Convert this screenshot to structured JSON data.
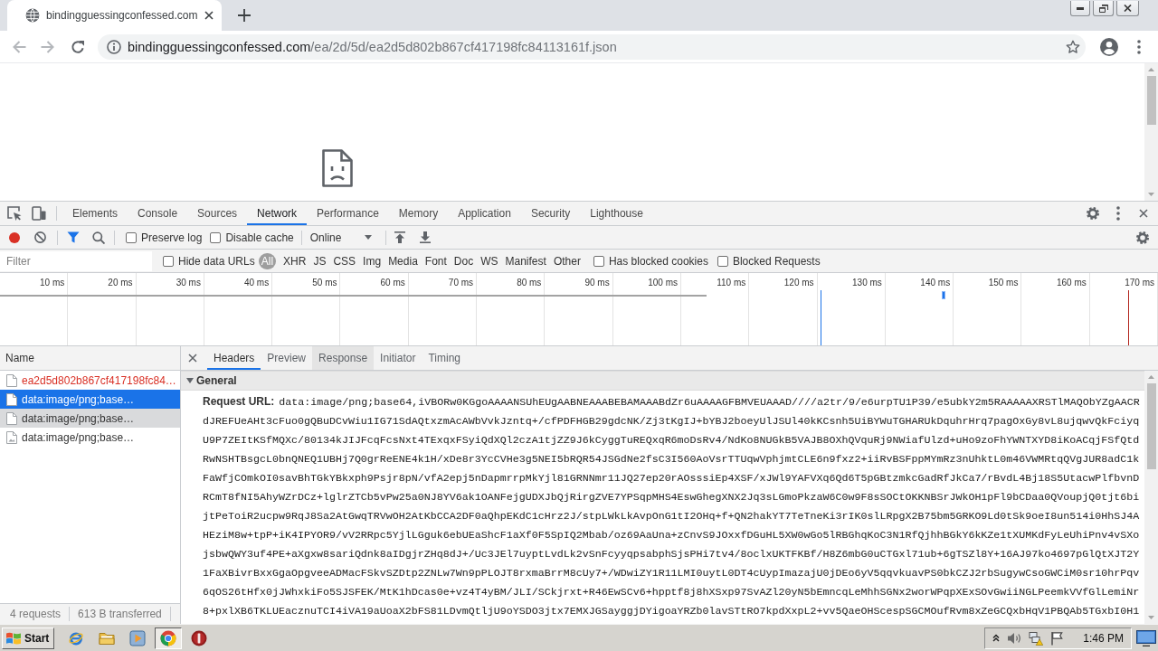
{
  "browser": {
    "tab": {
      "title": "bindingguessingconfessed.com"
    },
    "navigation": {
      "back": {
        "disabled": true
      },
      "forward": {
        "disabled": true
      }
    },
    "address": {
      "host": "bindingguessingconfessed.com",
      "path": "/ea/2d/5d/ea2d5d802b867cf417198fc84113161f.json"
    }
  },
  "devtools": {
    "panels": [
      {
        "label": "Elements",
        "selected": false
      },
      {
        "label": "Console",
        "selected": false
      },
      {
        "label": "Sources",
        "selected": false
      },
      {
        "label": "Network",
        "selected": true
      },
      {
        "label": "Performance",
        "selected": false
      },
      {
        "label": "Memory",
        "selected": false
      },
      {
        "label": "Application",
        "selected": false
      },
      {
        "label": "Security",
        "selected": false
      },
      {
        "label": "Lighthouse",
        "selected": false
      }
    ],
    "network_toolbar": {
      "recording": true,
      "filter_open": true,
      "checkboxes": [
        {
          "label": "Preserve log",
          "checked": false
        },
        {
          "label": "Disable cache",
          "checked": false
        }
      ],
      "throttling": "Online"
    },
    "filter_bar": {
      "placeholder": "Filter",
      "hide_data_urls": {
        "label": "Hide data URLs",
        "checked": false
      },
      "types": [
        {
          "label": "All",
          "selected": true
        },
        {
          "label": "XHR",
          "selected": false
        },
        {
          "label": "JS",
          "selected": false
        },
        {
          "label": "CSS",
          "selected": false
        },
        {
          "label": "Img",
          "selected": false
        },
        {
          "label": "Media",
          "selected": false
        },
        {
          "label": "Font",
          "selected": false
        },
        {
          "label": "Doc",
          "selected": false
        },
        {
          "label": "WS",
          "selected": false
        },
        {
          "label": "Manifest",
          "selected": false
        },
        {
          "label": "Other",
          "selected": false
        }
      ],
      "more_checkboxes": [
        {
          "label": "Has blocked cookies",
          "checked": false
        },
        {
          "label": "Blocked Requests",
          "checked": false
        }
      ]
    },
    "overview": {
      "ticks": [
        "10 ms",
        "20 ms",
        "30 ms",
        "40 ms",
        "50 ms",
        "60 ms",
        "70 ms",
        "80 ms",
        "90 ms",
        "100 ms",
        "110 ms",
        "120 ms",
        "130 ms",
        "140 ms",
        "150 ms",
        "160 ms",
        "170 ms"
      ]
    },
    "requests": {
      "column": "Name",
      "rows": [
        {
          "name": "ea2d5d802b867cf417198fc84…",
          "kind": "document",
          "selected": false,
          "failed": true,
          "hovered": false
        },
        {
          "name": "data:image/png;base…",
          "kind": "document",
          "selected": true,
          "failed": false,
          "hovered": false
        },
        {
          "name": "data:image/png;base…",
          "kind": "document",
          "selected": false,
          "failed": false,
          "hovered": true
        },
        {
          "name": "data:image/png;base…",
          "kind": "image",
          "selected": false,
          "failed": false,
          "hovered": false
        }
      ],
      "summary": [
        "4 requests",
        "613 B transferred"
      ]
    },
    "details": {
      "tabs": [
        {
          "label": "Headers",
          "selected": true,
          "hovered": false
        },
        {
          "label": "Preview",
          "selected": false,
          "hovered": false
        },
        {
          "label": "Response",
          "selected": false,
          "hovered": true
        },
        {
          "label": "Initiator",
          "selected": false,
          "hovered": false
        },
        {
          "label": "Timing",
          "selected": false,
          "hovered": false
        }
      ],
      "section": {
        "title": "General",
        "expanded": true
      },
      "request_url": {
        "label": "Request URL:",
        "value": "data:image/png;base64,iVBORw0KGgoAAAANSUhEUgAABNEAAABEBAMAAABdZr6uAAAAGFBMVEUAAAD////a2tr/9/e6urpTU1P39/e5ubkY2m5RAAAAAXRSTlMAQObYZgAACRdJREFUeAHt3cFuo0gQBuDCvWiu1IG71SdAQtxzmAcAWbVvkJzntq+/cfPDFHGB29gdcNK/Zj3tKgIJ+bYBJ2boeyUlJSUl40kKCsnh5UiBYWuTGHARUkDquhrHrq7pagOxGy8vL8ujqwvQkFciyqU9P7ZEItKSfMQXc/80134kJIJFcqFcsNxt4TExqxFSyiQdXQl2czA1tjZZ9J6kCyggTuREQxqR6moDsRv4/NdKo8NUGkB5VAJB8OXhQVquRj9NWiafUlzd+uHo9zoFhYWNTXYD8iKoACqjFSfQtdRwNSHTBsgcL0bnQNEQ1UBHj7Q0grReENE4k1H/xDe8r3YcCVHe3g5NEI5bRQR54JSGdNe2fsC3I560AoVsrTTUqwVphjmtCLE6n9fxz2+iiRvBSFppMYmRz3nUhktL0m46VWMRtqQVgJUR8adC1kFaWfjCOmkOI0savBhTGkYBkxph9Psjr8pN/vfA2epj5nDapmrrpMkYjl81GRNNmr11JQ27ep20rAOsssiEp4XSF/xJWl9YAFVXq6Qd6T5pGBtzmkcGadRfJkCa7/rBvdL4Bj18S5UtacwPlfbvnDRCmT8fNI5AhyWZrDCz+lglrZTCb5vPw25a0NJ8YV6ak1OANFejgUDXJbQjRirgZVE7YPSqpMHS4EswGhegXNX2Jq3sLGmoPkzaW6C0w9F8sSOCtOKKNBSrJWkOH1pFl9bCDaa0QVoupjQ0tjt6bijtPeToiR2ucpw9RqJ8Sa2AtGwqTRVwOH2AtKbCCA2DF0aQhpEKdC1cHrz2J/stpLWkLkAvpOnG1tI2OHq+f+QN2hakYT7TeTneKi3rIK0slLRpgX2B75bm5GRKO9Ld0tSk9oeI8un514i0HhSJ4AHEziM8w+tpP+iK4IPYOR9/vV2RRpc5YjlLGguk6ebUEaShcF1aXf0F5SpIQ2Mbab/oz69AaUna+zCnvS9JOxxfDGuHL5XW0wGo5lRBGhqKoC3N1RfQjhhBGkY6kKZe1tXUMKdFyLeUhiPnv4vSXojsbwQWY3uf4PE+aXgxw8sariQdnk8aIDgjrZHq8dJ+/Uc3JEl7uyptLvdLk2vSnFcyyqpsabphSjsPHi7tv4/8oclxUKTFKBf/H8Z6mbG0uCTGxl71ub+6gTSZl8Y+16AJ97ko4697pGlQtXJT2Y1FaXBivrBxxGgaOpgveeADMacFSkvSZDtp2ZNLw7Wn9pPLOJT8rxmaBrrM8cUy7+/WDwiZY1R11LMI0uytL0DT4cUypImazajU0jDEo6yV5qqvkuavPS0bkCZJ2rbSugywCsoGWCiM0sr10hrPqv6qOS26tHfx0jJWhxkiFo5SJSFEK/MtK1hDcas0e+vz4T4yBM/JLI/SCkjrxt+R46EwSCv6+hpptf8j8hXSxp97SvAZl20yN5bEmncqLeMhhSGNx2worWPqpXExSOvGwiiNGLPeemkVVfGlLemiNr8+pxlXB6TKLUEacznuTCI4iVA19aUoaX2bFS81LDvmQtljU9oYSDO3jtx7EMXJGSayggjDYigoaYRZb0lavSTtRO7kpdXxpL2+vv5QaeOHScespSGCMOufRvm8xZeGCQxbHqV1PBQAb5TGxbI0H1"
      }
    }
  },
  "taskbar": {
    "start": "Start",
    "apps": [
      {
        "kind": "e-logo",
        "selected": false
      },
      {
        "kind": "folder",
        "selected": false
      },
      {
        "kind": "player",
        "selected": false
      },
      {
        "kind": "round-browser",
        "selected": true
      },
      {
        "kind": "red-disc",
        "selected": false
      }
    ],
    "clock": "1:46 PM"
  }
}
